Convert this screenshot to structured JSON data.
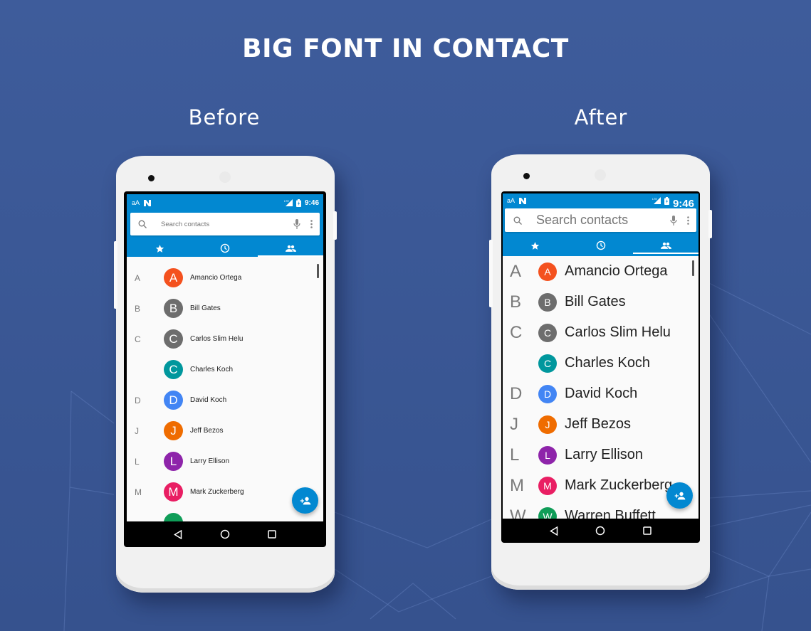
{
  "headline": "BIG FONT IN CONTACT",
  "labels": {
    "before": "Before",
    "after": "After"
  },
  "colors": {
    "background": "#3d5a99",
    "app_bar": "#0288d1",
    "fab": "#0288d1",
    "list_background": "#fafafa"
  },
  "phones": {
    "before": {
      "status": {
        "left_text": "aA",
        "left_icon": "n-icon",
        "signal_icon": "lte-signal-icon",
        "battery_icon": "battery-charging-icon",
        "time": "9:46"
      },
      "search": {
        "placeholder": "Search contacts",
        "leading_icon": "search-icon",
        "mic_icon": "mic-icon",
        "overflow_icon": "more-vert-icon"
      },
      "tabs": [
        {
          "icon": "star-icon",
          "name": "favorites",
          "active": false
        },
        {
          "icon": "clock-icon",
          "name": "recents",
          "active": false
        },
        {
          "icon": "people-icon",
          "name": "contacts",
          "active": true
        }
      ],
      "contacts": [
        {
          "letter": "A",
          "initial": "A",
          "name": "Amancio Ortega",
          "color": "#f4511e"
        },
        {
          "letter": "B",
          "initial": "B",
          "name": "Bill Gates",
          "color": "#6d6d6d"
        },
        {
          "letter": "C",
          "initial": "C",
          "name": "Carlos Slim Helu",
          "color": "#6d6d6d"
        },
        {
          "letter": "",
          "initial": "C",
          "name": "Charles Koch",
          "color": "#00979d"
        },
        {
          "letter": "D",
          "initial": "D",
          "name": "David Koch",
          "color": "#4285f4"
        },
        {
          "letter": "J",
          "initial": "J",
          "name": "Jeff Bezos",
          "color": "#ef6c00"
        },
        {
          "letter": "L",
          "initial": "L",
          "name": "Larry Ellison",
          "color": "#8e24aa"
        },
        {
          "letter": "M",
          "initial": "M",
          "name": "Mark Zuckerberg",
          "color": "#e91e63"
        },
        {
          "letter": "",
          "initial": "",
          "name": "",
          "color": "#0f9d58"
        }
      ],
      "fab_icon": "add-person-icon",
      "nav": [
        "back-icon",
        "home-icon",
        "recents-icon"
      ]
    },
    "after": {
      "status": {
        "left_text": "aA",
        "left_icon": "n-icon",
        "signal_icon": "lte-signal-icon",
        "battery_icon": "battery-charging-icon",
        "time": "9:46"
      },
      "search": {
        "placeholder": "Search contacts",
        "leading_icon": "search-icon",
        "mic_icon": "mic-icon",
        "overflow_icon": "more-vert-icon"
      },
      "tabs": [
        {
          "icon": "star-icon",
          "name": "favorites",
          "active": false
        },
        {
          "icon": "clock-icon",
          "name": "recents",
          "active": false
        },
        {
          "icon": "people-icon",
          "name": "contacts",
          "active": true
        }
      ],
      "contacts": [
        {
          "letter": "A",
          "initial": "A",
          "name": "Amancio Ortega",
          "color": "#f4511e"
        },
        {
          "letter": "B",
          "initial": "B",
          "name": "Bill Gates",
          "color": "#6d6d6d"
        },
        {
          "letter": "C",
          "initial": "C",
          "name": "Carlos Slim Helu",
          "color": "#6d6d6d"
        },
        {
          "letter": "",
          "initial": "C",
          "name": "Charles Koch",
          "color": "#00979d"
        },
        {
          "letter": "D",
          "initial": "D",
          "name": "David Koch",
          "color": "#4285f4"
        },
        {
          "letter": "J",
          "initial": "J",
          "name": "Jeff Bezos",
          "color": "#ef6c00"
        },
        {
          "letter": "L",
          "initial": "L",
          "name": "Larry Ellison",
          "color": "#8e24aa"
        },
        {
          "letter": "M",
          "initial": "M",
          "name": "Mark Zuckerberg",
          "color": "#e91e63"
        },
        {
          "letter": "W",
          "initial": "W",
          "name": "Warren Buffett",
          "color": "#0f9d58"
        }
      ],
      "fab_icon": "add-person-icon",
      "nav": [
        "back-icon",
        "home-icon",
        "recents-icon"
      ]
    }
  }
}
